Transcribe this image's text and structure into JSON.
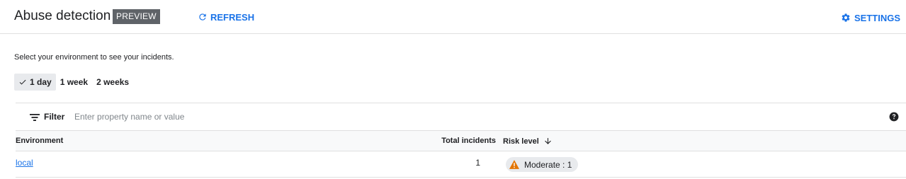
{
  "header": {
    "title": "Abuse detection",
    "badge": "PREVIEW",
    "refresh_label": "REFRESH",
    "settings_label": "SETTINGS",
    "accent_color": "#1a73e8"
  },
  "prompt": "Select your environment to see your incidents.",
  "time_ranges": [
    {
      "label": "1 day",
      "selected": true
    },
    {
      "label": "1 week",
      "selected": false
    },
    {
      "label": "2 weeks",
      "selected": false
    }
  ],
  "filter": {
    "label": "Filter",
    "placeholder": "Enter property name or value",
    "icon": "filter-icon",
    "help_icon": "help-icon"
  },
  "table": {
    "columns": {
      "environment": "Environment",
      "total_incidents": "Total incidents",
      "risk_level": "Risk level",
      "sort": "descending"
    },
    "rows": [
      {
        "environment": "local",
        "total_incidents": "1",
        "risk": "Moderate : 1",
        "risk_icon": "warning-icon",
        "risk_color": "#e37400"
      }
    ]
  }
}
